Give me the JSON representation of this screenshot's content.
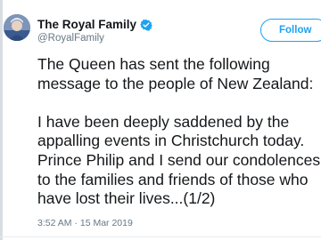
{
  "account": {
    "display_name": "The Royal Family",
    "handle": "@RoyalFamily",
    "verified": true
  },
  "follow_button": {
    "label": "Follow"
  },
  "tweet": {
    "lines": [
      "The Queen has sent the following",
      "message to the people of New Zealand:",
      "",
      "I have been deeply saddened by the",
      "appalling events in Christchurch today.",
      "Prince Philip and I send our condolences",
      "to the families and friends of those who",
      "have lost their lives...(1/2)"
    ],
    "timestamp": "3:52 AM · 15 Mar 2019"
  },
  "colors": {
    "accent": "#1da1f2",
    "text": "#14171a",
    "secondary_text": "#657786"
  },
  "icons": {
    "verified": "verified-badge-icon",
    "avatar": "profile-avatar"
  }
}
